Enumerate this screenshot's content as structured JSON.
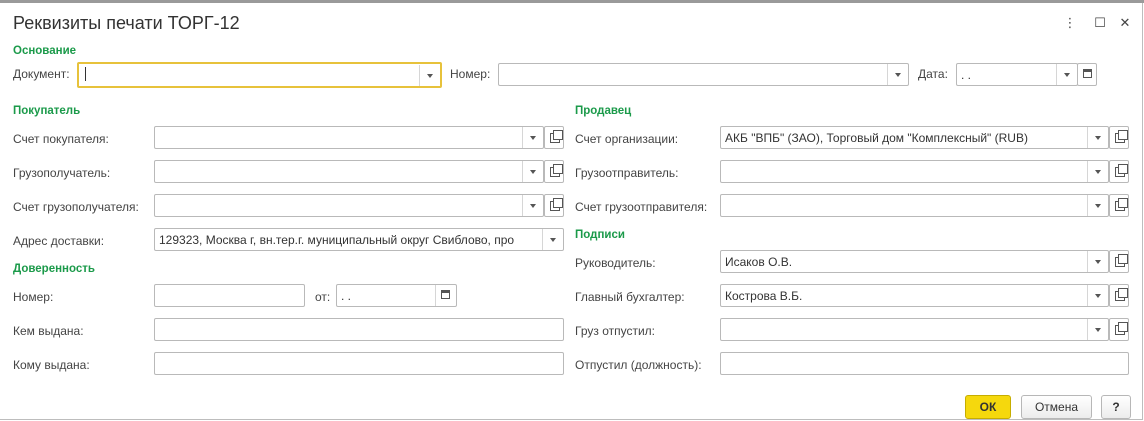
{
  "window": {
    "title": "Реквизиты печати ТОРГ-12",
    "more_icon": "⋮",
    "maximize_icon": "☐",
    "close_icon": "✕"
  },
  "osnovanie": {
    "section": "Основание",
    "document_label": "Документ:",
    "document_value": "",
    "number_label": "Номер:",
    "number_value": "",
    "date_label": "Дата:",
    "date_value": " .  ."
  },
  "buyer": {
    "section": "Покупатель",
    "account_label": "Счет покупателя:",
    "account_value": "",
    "consignee_label": "Грузополучатель:",
    "consignee_value": "",
    "consignee_account_label": "Счет грузополучателя:",
    "consignee_account_value": "",
    "address_label": "Адрес доставки:",
    "address_value": "129323, Москва г, вн.тер.г. муниципальный округ Свиблово, про"
  },
  "proxy": {
    "section": "Доверенность",
    "number_label": "Номер:",
    "number_value": "",
    "from_label": "от:",
    "from_value": " .  .",
    "issued_by_label": "Кем выдана:",
    "issued_by_value": "",
    "issued_to_label": "Кому выдана:",
    "issued_to_value": ""
  },
  "seller": {
    "section": "Продавец",
    "org_account_label": "Счет организации:",
    "org_account_value": "АКБ \"ВПБ\" (ЗАО), Торговый дом \"Комплексный\" (RUB)",
    "shipper_label": "Грузоотправитель:",
    "shipper_value": "",
    "shipper_account_label": "Счет грузоотправителя:",
    "shipper_account_value": ""
  },
  "signatures": {
    "section": "Подписи",
    "head_label": "Руководитель:",
    "head_value": "Исаков О.В.",
    "accountant_label": "Главный бухгалтер:",
    "accountant_value": "Кострова В.Б.",
    "released_label": "Груз отпустил:",
    "released_value": "",
    "position_label": "Отпустил (должность):",
    "position_value": ""
  },
  "buttons": {
    "ok": "ОК",
    "cancel": "Отмена",
    "help": "?"
  }
}
